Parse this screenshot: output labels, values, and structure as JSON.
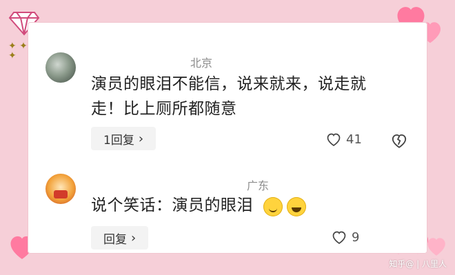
{
  "comments": [
    {
      "location": "北京",
      "text": "演员的眼泪不能信，说来就来，说走就走！比上厕所都随意",
      "reply": {
        "label": "1回复"
      },
      "likes": "41"
    },
    {
      "location": "广东",
      "text": "说个笑话：演员的眼泪",
      "reply": {
        "label": "回复"
      },
      "likes": "9"
    }
  ],
  "colors": {
    "background": "#f6cfd8",
    "card": "#ffffff",
    "text": "#222222",
    "muted": "#8d8d8d",
    "accent": "#ff6f9b"
  },
  "watermark": "知乎@ | 八里人",
  "icons": {
    "heart": "heart-icon",
    "broken_heart": "broken-heart-icon",
    "chevron": "chevron-right-icon"
  }
}
